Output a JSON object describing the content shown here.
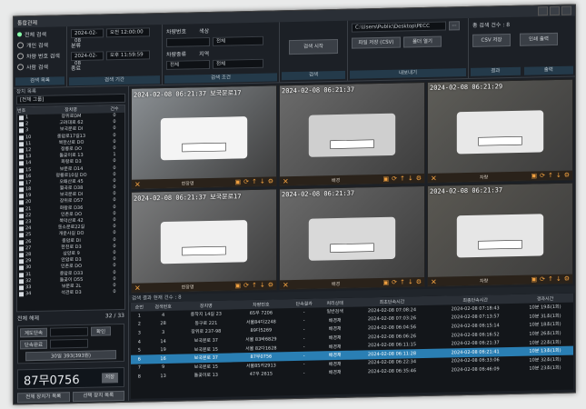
{
  "window": {
    "title": "통합관제",
    "controls": [
      "–",
      "□",
      "×"
    ]
  },
  "toolbar": {
    "search_type": {
      "options": [
        "전체 검색",
        "개인 검색",
        "차량 번호 검색",
        "사람 검색"
      ],
      "foot": "검색 목록"
    },
    "time": {
      "start_date": "2024-02-08",
      "start_time": "오전 12:00:00",
      "end_date": "2024-02-08",
      "end_time": "오후 11:59:59",
      "label1": "분류",
      "label2": "종료",
      "foot": "검색 기간"
    },
    "condition": {
      "plate_label": "차량번호",
      "color_label": "색상",
      "color_value": "전체",
      "type_label": "차량종류",
      "type_value": "전체",
      "region_label": "지역",
      "region_value": "전체",
      "foot": "검색 조건"
    },
    "search": {
      "button": "검색 시작",
      "foot": "검색"
    },
    "export": {
      "path": "C:\\Users\\Public\\Desktop\\PECC",
      "btn1": "파일 저장 (CSV)",
      "btn2": "폴더 열기",
      "foot": "내보내기"
    },
    "result": {
      "label": "총 검색 건수 : 8",
      "btn1": "CSV 저장",
      "btn2": "인쇄 출력",
      "foot1": "결과",
      "foot2": "출력"
    }
  },
  "left": {
    "header": "장치 목록",
    "filter": "[전체 그룹]",
    "columns": [
      "번호",
      "장치명",
      "건수"
    ],
    "devices": [
      [
        "1",
        "장위로DM",
        "0"
      ],
      [
        "2",
        "고려대로 62",
        "0"
      ],
      [
        "3",
        "보국문로 DI",
        "0"
      ],
      [
        "10",
        "종암로17길13",
        "0"
      ],
      [
        "11",
        "북한산로 DO",
        "0"
      ],
      [
        "12",
        "정릉로 DO",
        "0"
      ],
      [
        "13",
        "돌곶이로 13",
        "1"
      ],
      [
        "14",
        "화랑로 D3",
        "0"
      ],
      [
        "15",
        "보문로 D14",
        "0"
      ],
      [
        "16",
        "정릉로10길 DO",
        "0"
      ],
      [
        "17",
        "오패산로 45",
        "0"
      ],
      [
        "18",
        "월곡로 D38",
        "0"
      ],
      [
        "19",
        "보국문로 DI",
        "0"
      ],
      [
        "20",
        "장위로 D57",
        "0"
      ],
      [
        "21",
        "화랑로 D36",
        "0"
      ],
      [
        "22",
        "인촌로 DO",
        "0"
      ],
      [
        "23",
        "북악산로 42",
        "0"
      ],
      [
        "24",
        "동소문로22길",
        "0"
      ],
      [
        "25",
        "개운사길 DO",
        "0"
      ],
      [
        "26",
        "종암로 DI",
        "0"
      ],
      [
        "27",
        "한천로 D3",
        "0"
      ],
      [
        "28",
        "삼양로 9",
        "0"
      ],
      [
        "29",
        "안암로 D3",
        "0"
      ],
      [
        "30",
        "인촌로 DO",
        "0"
      ],
      [
        "31",
        "종암로 D33",
        "0"
      ],
      [
        "32",
        "돌곶이 D55",
        "0"
      ],
      [
        "33",
        "보문로 2L",
        "0"
      ],
      [
        "34",
        "석관로 D3",
        "0"
      ]
    ],
    "footer_label": "전체 해제",
    "footer_count": "32 / 33",
    "ctrl1": "계도단속",
    "ctrl2": "단속완료",
    "ctrl_btn": "확인",
    "rate": "30일 393(393원)",
    "plate": "87무0756",
    "plate_btn": "저장",
    "bottom1": "전체 장치가 목록",
    "bottom2": "선택 장치 목록"
  },
  "cams": [
    {
      "ts": "2024-02-08 06:21:37 보국문로17",
      "label": "현장명",
      "selected": false
    },
    {
      "ts": "2024-02-08 06:21:37",
      "label": "배경",
      "selected": false
    },
    {
      "ts": "2024-02-08 06:21:29",
      "label": "차량",
      "selected": false
    },
    {
      "ts": "2024-02-08 06:21:37 보국문로17",
      "label": "현장명",
      "selected": false
    },
    {
      "ts": "2024-02-08 06:21:37",
      "label": "배경",
      "selected": false
    },
    {
      "ts": "2024-02-08 06:21:37",
      "label": "차량",
      "selected": false
    }
  ],
  "results": {
    "header": "검색 결과 현재 건수 : 8",
    "columns": [
      "순번",
      "검색번호",
      "장치명",
      "차량번호",
      "단속결과",
      "처리상태",
      "최초단속시간",
      "최종단속시간",
      "경과시간"
    ],
    "rows": [
      [
        "1",
        "4",
        "종착지 14길 23",
        "65무 7206",
        "-",
        "일반검색",
        "2024-02-08 07:08:24",
        "2024-02-08 07:18:43",
        "10분 19초(1회)"
      ],
      [
        "2",
        "28",
        "동구로 221",
        "서울84다2248",
        "-",
        "배경채",
        "2024-02-08 07:03:26",
        "2024-02-08 07:13:57",
        "10분 31초(1회)"
      ],
      [
        "3",
        "3",
        "장위로 237-98",
        "89다5269",
        "-",
        "배경채",
        "2024-02-08 06:04:56",
        "2024-02-08 06:15:14",
        "10분 18초(1회)"
      ],
      [
        "4",
        "14",
        "보국문로 37",
        "서울 83바6829",
        "-",
        "배경채",
        "2024-02-08 06:06:26",
        "2024-02-08 06:16:52",
        "10분 26초(1회)"
      ],
      [
        "5",
        "19",
        "보국문로 15",
        "서울 82다1628",
        "-",
        "배경채",
        "2024-02-08 06:11:15",
        "2024-02-08 06:21:37",
        "10분 22초(1회)"
      ],
      [
        "6",
        "16",
        "보국문로 37",
        "87무0756",
        "-",
        "배경채",
        "2024-02-08 06:11:28",
        "2024-02-08 06:21:41",
        "10분 13초(1회)"
      ],
      [
        "7",
        "9",
        "보국문로 15",
        "서울85카2913",
        "-",
        "배경채",
        "2024-02-08 06:22:34",
        "2024-02-08 06:33:06",
        "10분 32초(1회)"
      ],
      [
        "8",
        "13",
        "돌곶이로 13",
        "47우 2615",
        "-",
        "배경채",
        "2024-02-08 06:35:46",
        "2024-02-08 06:46:09",
        "10분 23초(1회)"
      ]
    ],
    "highlight": 5
  }
}
